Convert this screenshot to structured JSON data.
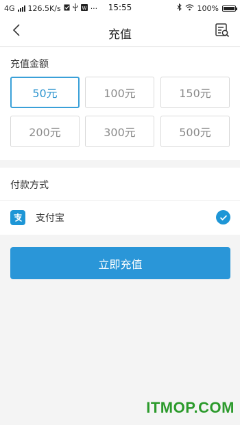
{
  "status_bar": {
    "network": "4G",
    "speed": "126.5K/s",
    "time": "15:55",
    "battery": "100%",
    "battery_level": 1.0,
    "dots": "···"
  },
  "header": {
    "title": "充值",
    "back_icon": "chevron-left-icon",
    "record_icon": "record-list-icon"
  },
  "amount": {
    "label": "充值金额",
    "options": [
      "50元",
      "100元",
      "150元",
      "200元",
      "300元",
      "500元"
    ],
    "selected": "50元"
  },
  "payment": {
    "label": "付款方式",
    "method": "支付宝",
    "method_icon": "alipay-icon",
    "checked": true
  },
  "submit": {
    "label": "立即充值"
  },
  "watermark": "ITMOP.COM",
  "colors": {
    "accent": "#2a96d8",
    "selected_border": "#3aa0d8",
    "watermark": "#2b9a2b"
  }
}
